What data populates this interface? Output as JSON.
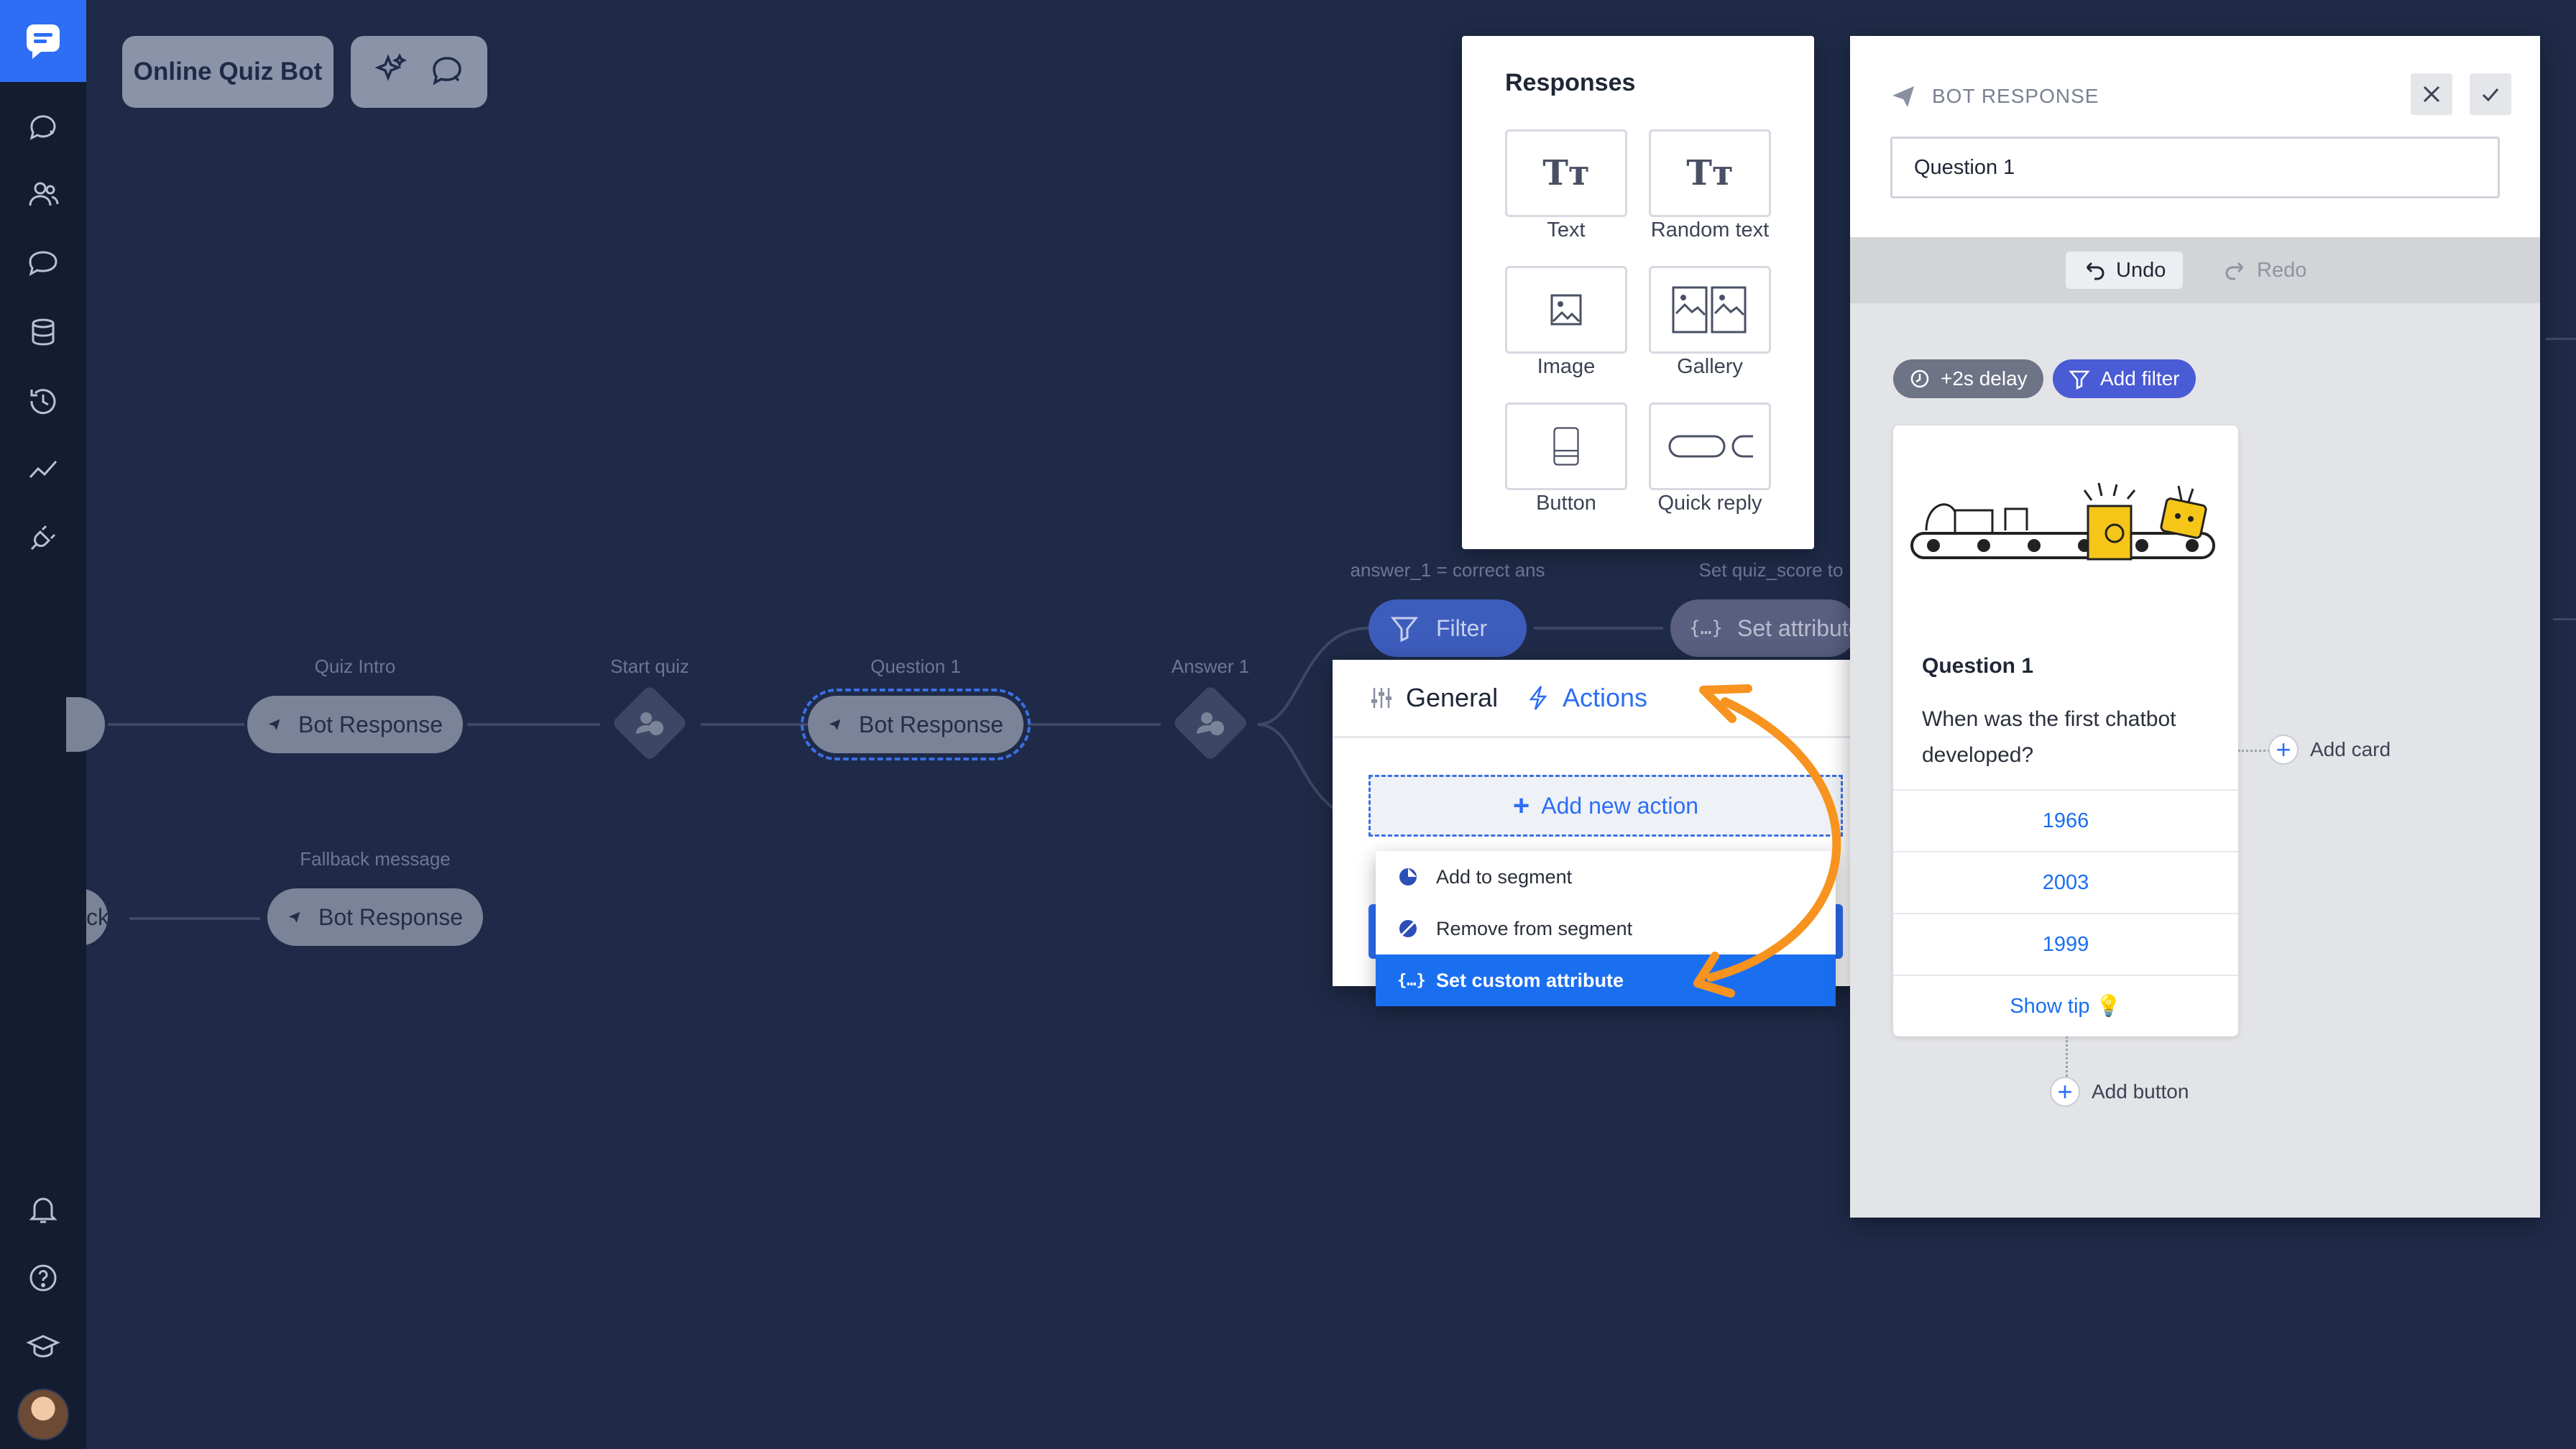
{
  "app": {
    "bot_name": "Online Quiz Bot"
  },
  "sidebar": {
    "items": [
      {
        "icon": "chat-bubble-icon"
      },
      {
        "icon": "users-icon"
      },
      {
        "icon": "speech-bubbles-icon"
      },
      {
        "icon": "database-icon"
      },
      {
        "icon": "history-icon"
      },
      {
        "icon": "analytics-icon"
      },
      {
        "icon": "plug-icon"
      }
    ],
    "bottom": [
      {
        "icon": "bell-icon"
      },
      {
        "icon": "help-icon"
      },
      {
        "icon": "academy-icon"
      }
    ]
  },
  "flow": {
    "nodes": [
      {
        "label": "Quiz Intro",
        "title": "Bot Response"
      },
      {
        "label": "Start quiz",
        "title": ""
      },
      {
        "label": "Question 1",
        "title": "Bot Response"
      },
      {
        "label": "Answer 1",
        "title": ""
      },
      {
        "label": "Fallback message",
        "title": "Bot Response"
      },
      {
        "label": "",
        "title": "ck"
      }
    ],
    "filter_label": "answer_1 = correct ans",
    "filter_title": "Filter",
    "attr_label": "Set quiz_score to",
    "attr_title": "Set attribute"
  },
  "responses": {
    "title": "Responses",
    "tiles": [
      "Text",
      "Random text",
      "Image",
      "Gallery",
      "Button",
      "Quick reply"
    ]
  },
  "actions_panel": {
    "tab_general": "General",
    "tab_actions": "Actions",
    "add_action": "Add new action",
    "menu": [
      "Add to segment",
      "Remove from segment",
      "Set custom attribute"
    ],
    "active_index": 2
  },
  "bot_response": {
    "header": "BOT RESPONSE",
    "name_value": "Question 1",
    "undo": "Undo",
    "redo": "Redo",
    "delay_chip": "+2s delay",
    "filter_chip": "Add filter",
    "card": {
      "title": "Question 1",
      "text": "When was the first chatbot developed?",
      "answers": [
        "1966",
        "2003",
        "1999"
      ],
      "tip": "Show tip"
    },
    "add_card": "Add card",
    "add_button": "Add button"
  },
  "colors": {
    "canvas": "#1e2a47",
    "accent": "#2d6ef5",
    "arrow": "#f7931e"
  }
}
